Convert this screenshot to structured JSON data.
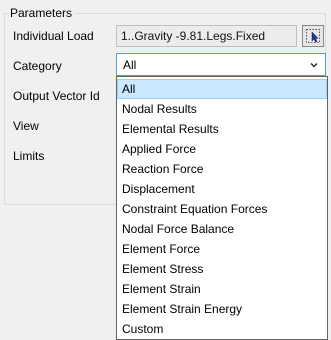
{
  "parameters": {
    "title": "Parameters",
    "individual_load": {
      "label": "Individual Load",
      "value": "1..Gravity -9.81.Legs.Fixed"
    },
    "category": {
      "label": "Category",
      "selected": "All",
      "options": [
        "All",
        "Nodal Results",
        "Elemental Results",
        "Applied Force",
        "Reaction Force",
        "Displacement",
        "Constraint Equation Forces",
        "Nodal Force Balance",
        "Element Force",
        "Element Stress",
        "Element Strain",
        "Element Strain Energy",
        "Custom"
      ]
    },
    "output_vector_id": {
      "label": "Output Vector Id"
    },
    "view": {
      "label": "View"
    },
    "limits": {
      "label": "Limits"
    }
  },
  "icons": {
    "pick": "pick-cursor-icon",
    "dropdown": "chevron-down-icon"
  },
  "colors": {
    "selection_bg": "#cce8ff",
    "selection_border": "#99d1ff",
    "focus_border": "#569de5"
  }
}
